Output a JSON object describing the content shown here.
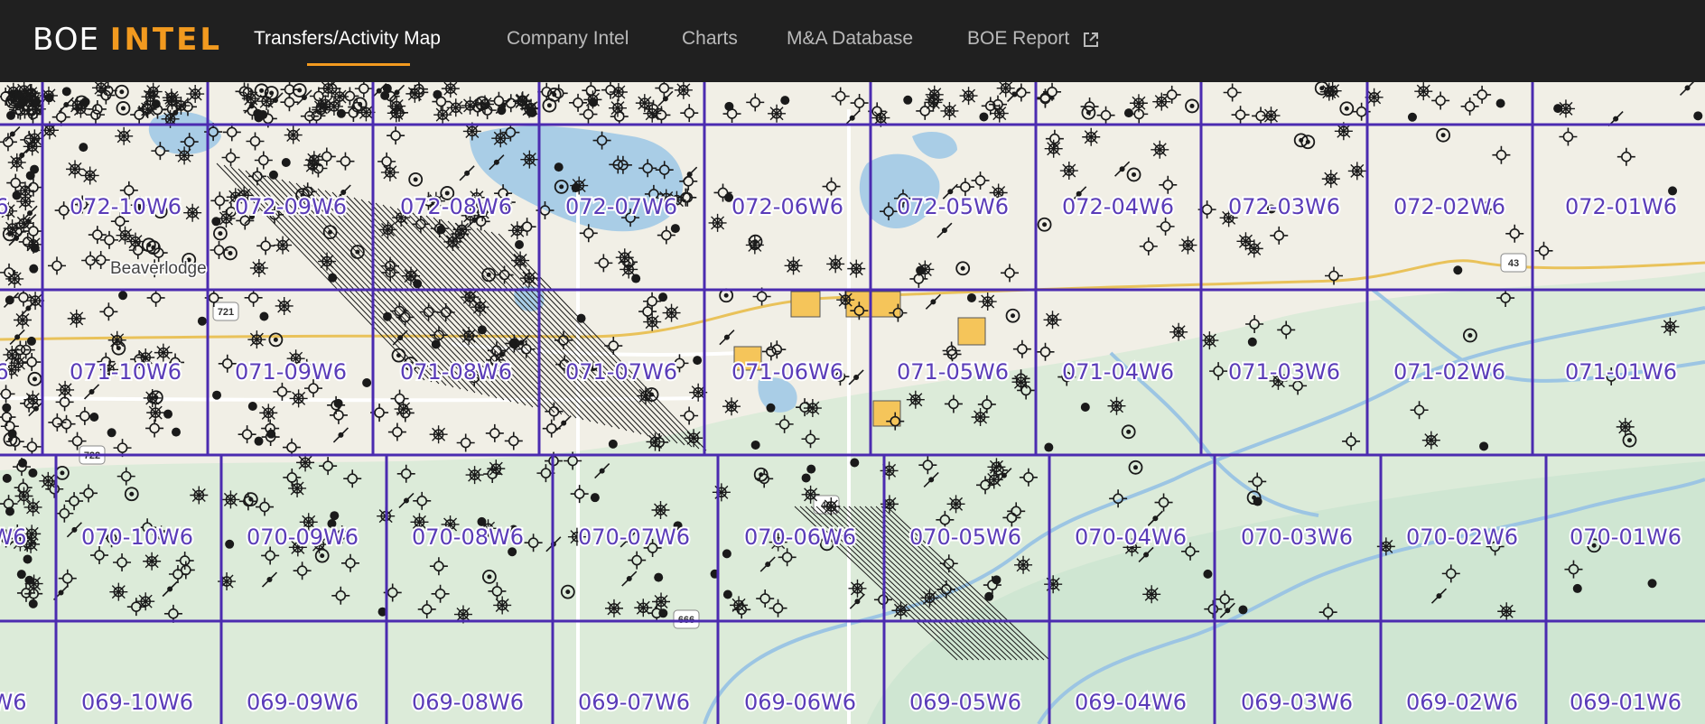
{
  "app": {
    "logo_part1": "BOE",
    "logo_part2": "INTEL",
    "accent_color": "#f29a1f"
  },
  "nav": {
    "items": [
      {
        "label": "Transfers/Activity Map",
        "active": true
      },
      {
        "label": "Company Intel",
        "active": false
      },
      {
        "label": "Charts",
        "active": false
      },
      {
        "label": "M&A Database",
        "active": false
      },
      {
        "label": "BOE Report",
        "active": false,
        "icon": "external-link-icon"
      }
    ]
  },
  "map": {
    "grid_color": "#4b2bb0",
    "place_labels": [
      "Beaverlodge"
    ],
    "highway_shields": [
      "43",
      "40",
      "722",
      "721",
      "666"
    ],
    "rows": [
      {
        "labels": [
          "6",
          "072-10W6",
          "072-09W6",
          "072-08W6",
          "072-07W6",
          "072-06W6",
          "072-05W6",
          "072-04W6",
          "072-03W6",
          "072-02W6",
          "072-01W6"
        ]
      },
      {
        "labels": [
          "6",
          "071-10W6",
          "071-09W6",
          "071-08W6",
          "071-07W6",
          "071-06W6",
          "071-05W6",
          "071-04W6",
          "071-03W6",
          "071-02W6",
          "071-01W6"
        ]
      },
      {
        "labels": [
          "W6",
          "070-10W6",
          "070-09W6",
          "070-08W6",
          "070-07W6",
          "070-06W6",
          "070-05W6",
          "070-04W6",
          "070-03W6",
          "070-02W6",
          "070-01W6"
        ]
      },
      {
        "labels": [
          "W6",
          "069-10W6",
          "069-09W6",
          "069-08W6",
          "069-07W6",
          "069-06W6",
          "069-05W6",
          "069-04W6",
          "069-03W6",
          "069-02W6",
          "069-01W6"
        ]
      }
    ]
  }
}
